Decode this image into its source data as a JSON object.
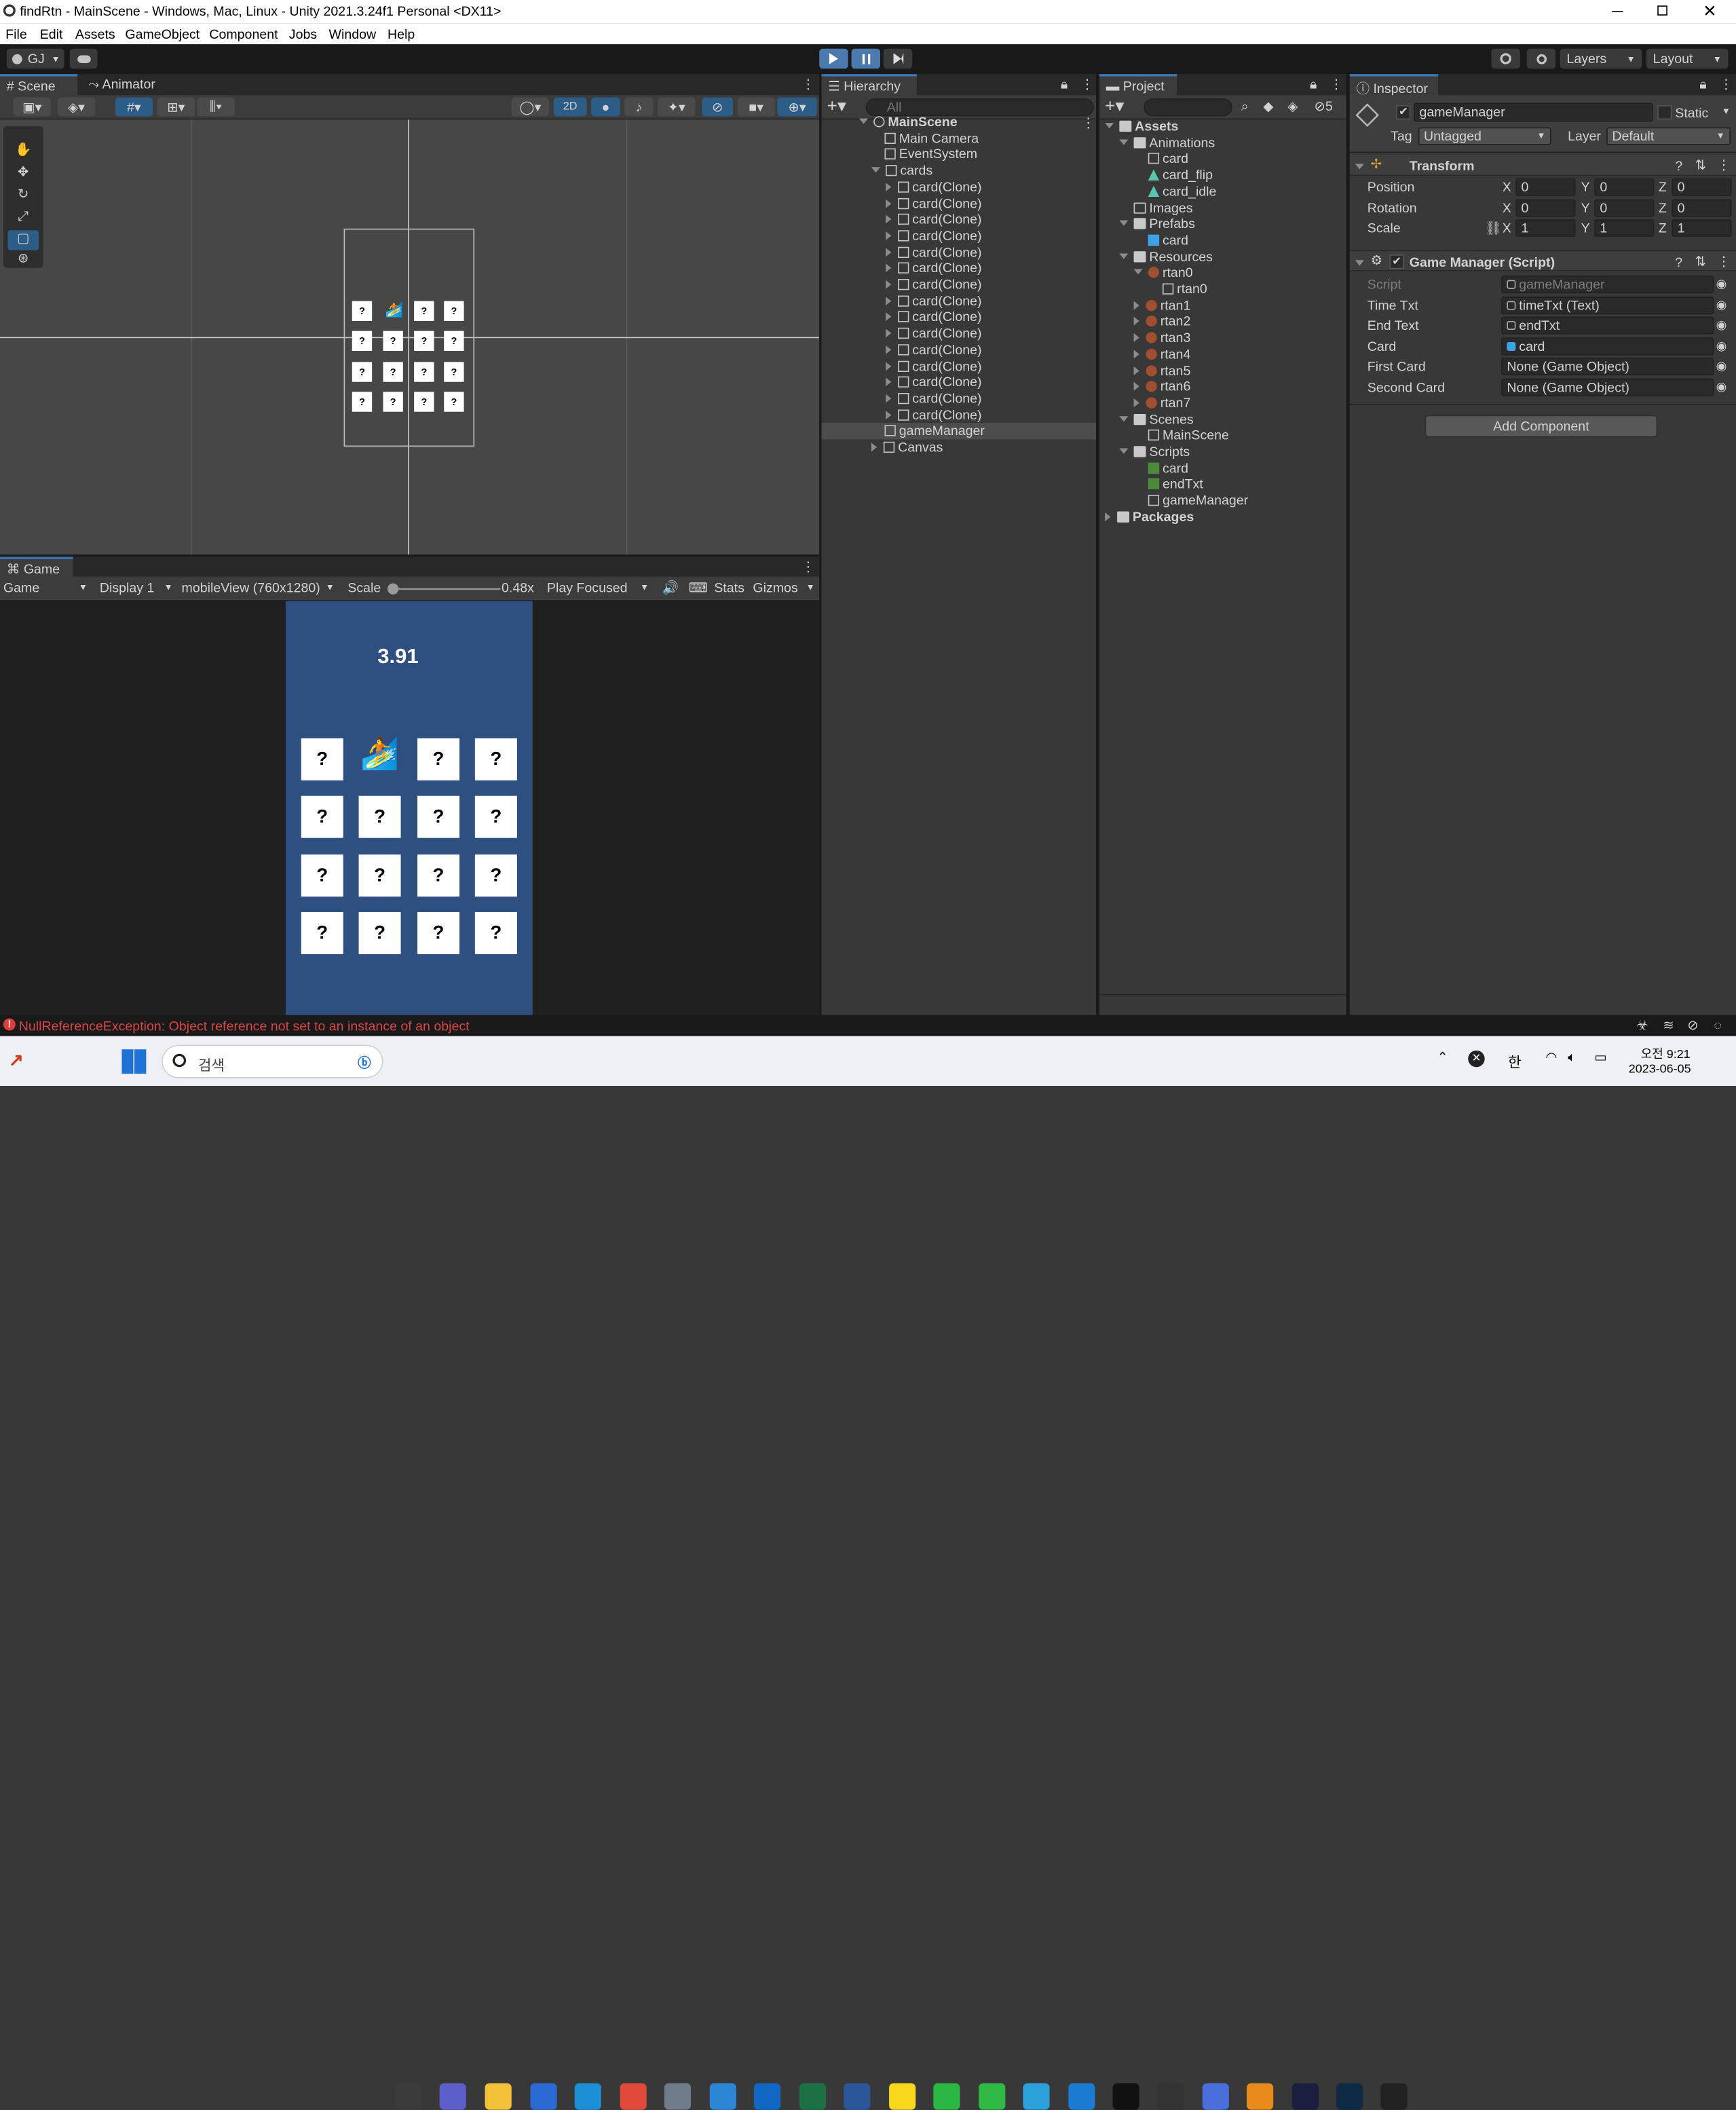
{
  "window": {
    "title": "findRtn - MainScene - Windows, Mac, Linux - Unity 2021.3.24f1 Personal <DX11>"
  },
  "menu": [
    "File",
    "Edit",
    "Assets",
    "GameObject",
    "Component",
    "Jobs",
    "Window",
    "Help"
  ],
  "toolbar": {
    "account": "GJ",
    "layers": "Layers",
    "layout": "Layout"
  },
  "scene": {
    "tab_scene": "Scene",
    "tab_animator": "Animator",
    "mode_2d": "2D",
    "card_symbol": "?"
  },
  "game": {
    "tab": "Game",
    "view": "Game",
    "display": "Display 1",
    "resolution": "mobileView (760x1280)",
    "scale_label": "Scale",
    "scale_value": "0.48x",
    "play_mode": "Play Focused",
    "stats": "Stats",
    "gizmos": "Gizmos",
    "timer": "3.91",
    "card_symbol": "?"
  },
  "hierarchy": {
    "tab": "Hierarchy",
    "search_placeholder": "All",
    "scene": "MainScene",
    "items": [
      "Main Camera",
      "EventSystem",
      "cards"
    ],
    "clone_label": "card(Clone)",
    "clone_count": 15,
    "after": [
      "gameManager",
      "Canvas"
    ]
  },
  "project": {
    "tab": "Project",
    "hidden_count": "5",
    "tree": [
      {
        "label": "Assets",
        "depth": 0,
        "kind": "folder",
        "bold": true
      },
      {
        "label": "Animations",
        "depth": 1,
        "kind": "folder"
      },
      {
        "label": "card",
        "depth": 2,
        "kind": "anim"
      },
      {
        "label": "card_flip",
        "depth": 2,
        "kind": "clip"
      },
      {
        "label": "card_idle",
        "depth": 2,
        "kind": "clip"
      },
      {
        "label": "Images",
        "depth": 1,
        "kind": "folder"
      },
      {
        "label": "Prefabs",
        "depth": 1,
        "kind": "folder"
      },
      {
        "label": "card",
        "depth": 2,
        "kind": "prefab"
      },
      {
        "label": "Resources",
        "depth": 1,
        "kind": "folder"
      },
      {
        "label": "rtan0",
        "depth": 2,
        "kind": "sprite"
      },
      {
        "label": "rtan0",
        "depth": 3,
        "kind": "sub"
      },
      {
        "label": "rtan1",
        "depth": 2,
        "kind": "sprite"
      },
      {
        "label": "rtan2",
        "depth": 2,
        "kind": "sprite"
      },
      {
        "label": "rtan3",
        "depth": 2,
        "kind": "sprite"
      },
      {
        "label": "rtan4",
        "depth": 2,
        "kind": "sprite"
      },
      {
        "label": "rtan5",
        "depth": 2,
        "kind": "sprite"
      },
      {
        "label": "rtan6",
        "depth": 2,
        "kind": "sprite"
      },
      {
        "label": "rtan7",
        "depth": 2,
        "kind": "sprite"
      },
      {
        "label": "Scenes",
        "depth": 1,
        "kind": "folder"
      },
      {
        "label": "MainScene",
        "depth": 2,
        "kind": "scene"
      },
      {
        "label": "Scripts",
        "depth": 1,
        "kind": "folder"
      },
      {
        "label": "card",
        "depth": 2,
        "kind": "script"
      },
      {
        "label": "endTxt",
        "depth": 2,
        "kind": "script"
      },
      {
        "label": "gameManager",
        "depth": 2,
        "kind": "gear"
      },
      {
        "label": "Packages",
        "depth": 0,
        "kind": "folder",
        "bold": true
      }
    ]
  },
  "inspector": {
    "tab": "Inspector",
    "object_name": "gameManager",
    "static_label": "Static",
    "tag_label": "Tag",
    "tag_value": "Untagged",
    "layer_label": "Layer",
    "layer_value": "Default",
    "transform": {
      "title": "Transform",
      "rows": [
        {
          "label": "Position",
          "x": "0",
          "y": "0",
          "z": "0"
        },
        {
          "label": "Rotation",
          "x": "0",
          "y": "0",
          "z": "0"
        },
        {
          "label": "Scale",
          "x": "1",
          "y": "1",
          "z": "1"
        }
      ]
    },
    "script": {
      "title": "Game Manager (Script)",
      "rows": [
        {
          "label": "Script",
          "value": "gameManager"
        },
        {
          "label": "Time Txt",
          "value": "timeTxt (Text)"
        },
        {
          "label": "End Text",
          "value": "endTxt"
        },
        {
          "label": "Card",
          "value": "card"
        },
        {
          "label": "First Card",
          "value": "None (Game Object)"
        },
        {
          "label": "Second Card",
          "value": "None (Game Object)"
        }
      ]
    },
    "add_component": "Add Component"
  },
  "console": {
    "error": "NullReferenceException: Object reference not set to an instance of an object"
  },
  "taskbar": {
    "search": "검색",
    "lang": "한",
    "time": "오전 9:21",
    "date": "2023-06-05"
  }
}
